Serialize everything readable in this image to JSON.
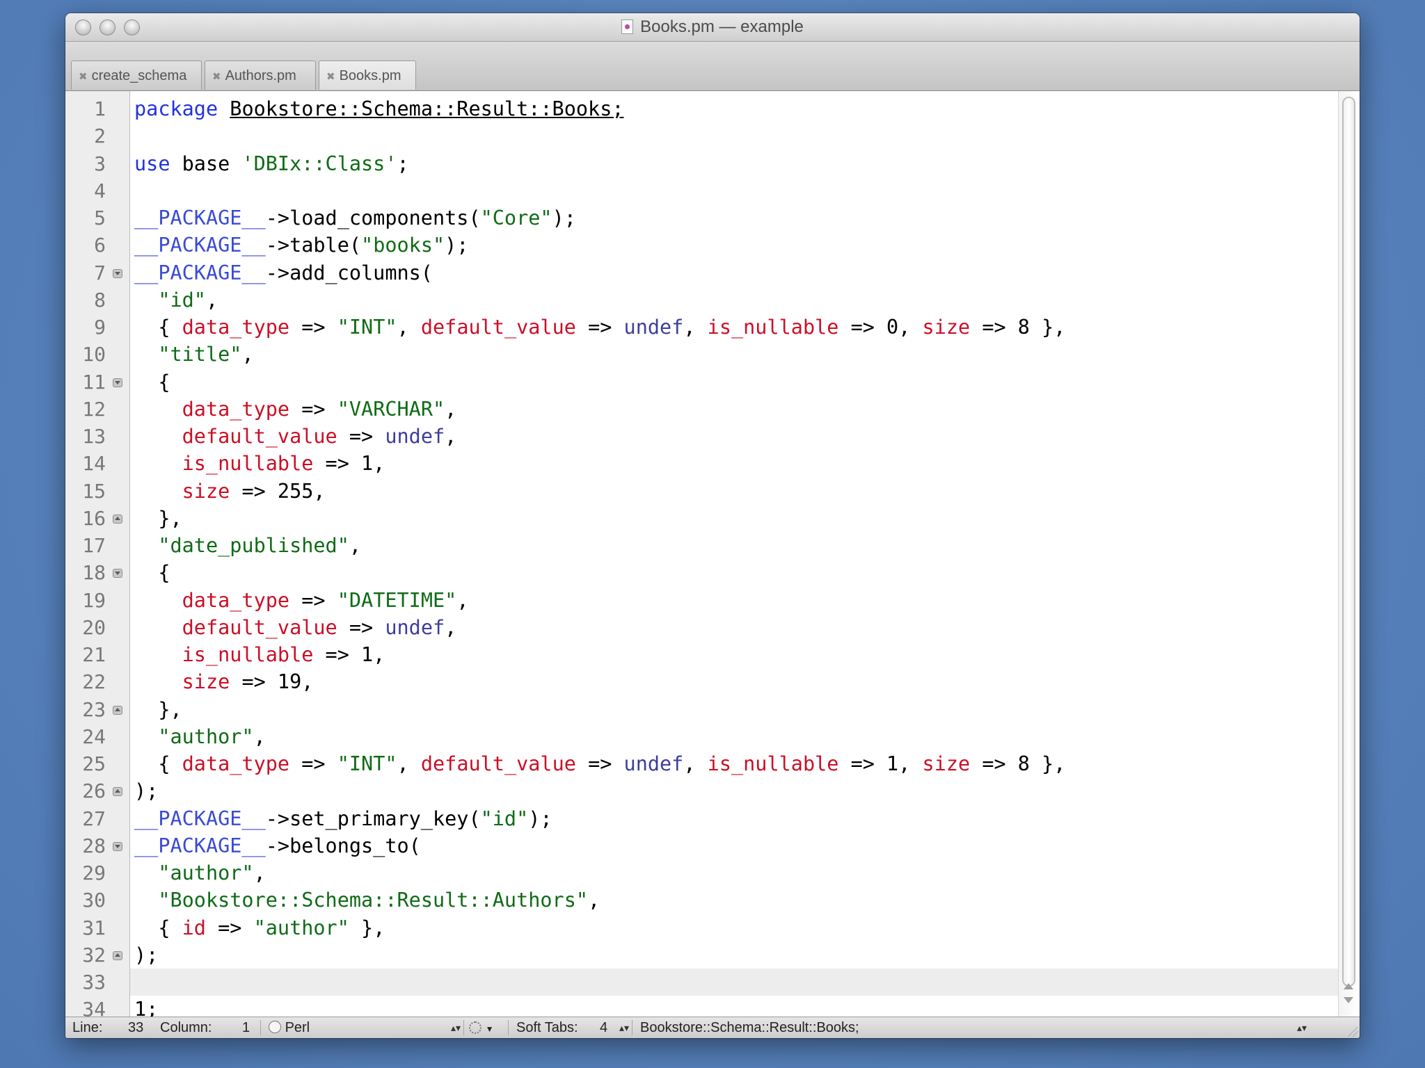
{
  "window": {
    "title": "Books.pm — example"
  },
  "tabs": [
    {
      "label": "create_schema",
      "active": false
    },
    {
      "label": "Authors.pm",
      "active": false
    },
    {
      "label": "Books.pm",
      "active": true
    }
  ],
  "editor": {
    "current_line": 33,
    "lines": [
      {
        "n": "1",
        "html": "<span class=\"kw\">package</span> <span class=\"pkg\">Bookstore::Schema::Result::Books;</span>"
      },
      {
        "n": "2",
        "html": ""
      },
      {
        "n": "3",
        "html": "<span class=\"kw\">use</span> base <span class=\"str\">'DBIx::Class'</span>;"
      },
      {
        "n": "4",
        "html": ""
      },
      {
        "n": "5",
        "html": "<span class=\"pk\">__PACKAGE__</span>-&gt;load_components(<span class=\"str\">\"Core\"</span>);"
      },
      {
        "n": "6",
        "html": "<span class=\"pk\">__PACKAGE__</span>-&gt;table(<span class=\"str\">\"books\"</span>);"
      },
      {
        "n": "7",
        "html": "<span class=\"pk\">__PACKAGE__</span>-&gt;add_columns(",
        "fold": "start"
      },
      {
        "n": "8",
        "html": "  <span class=\"str\">\"id\"</span>,"
      },
      {
        "n": "9",
        "html": "  { <span class=\"key\">data_type</span> =&gt; <span class=\"str\">\"INT\"</span>, <span class=\"key\">default_value</span> =&gt; <span class=\"und\">undef</span>, <span class=\"key\">is_nullable</span> =&gt; 0, <span class=\"key\">size</span> =&gt; 8 },"
      },
      {
        "n": "10",
        "html": "  <span class=\"str\">\"title\"</span>,"
      },
      {
        "n": "11",
        "html": "  {",
        "fold": "start"
      },
      {
        "n": "12",
        "html": "    <span class=\"key\">data_type</span> =&gt; <span class=\"str\">\"VARCHAR\"</span>,"
      },
      {
        "n": "13",
        "html": "    <span class=\"key\">default_value</span> =&gt; <span class=\"und\">undef</span>,"
      },
      {
        "n": "14",
        "html": "    <span class=\"key\">is_nullable</span> =&gt; 1,"
      },
      {
        "n": "15",
        "html": "    <span class=\"key\">size</span> =&gt; 255,"
      },
      {
        "n": "16",
        "html": "  },",
        "fold": "end"
      },
      {
        "n": "17",
        "html": "  <span class=\"str\">\"date_published\"</span>,"
      },
      {
        "n": "18",
        "html": "  {",
        "fold": "start"
      },
      {
        "n": "19",
        "html": "    <span class=\"key\">data_type</span> =&gt; <span class=\"str\">\"DATETIME\"</span>,"
      },
      {
        "n": "20",
        "html": "    <span class=\"key\">default_value</span> =&gt; <span class=\"und\">undef</span>,"
      },
      {
        "n": "21",
        "html": "    <span class=\"key\">is_nullable</span> =&gt; 1,"
      },
      {
        "n": "22",
        "html": "    <span class=\"key\">size</span> =&gt; 19,"
      },
      {
        "n": "23",
        "html": "  },",
        "fold": "end"
      },
      {
        "n": "24",
        "html": "  <span class=\"str\">\"author\"</span>,"
      },
      {
        "n": "25",
        "html": "  { <span class=\"key\">data_type</span> =&gt; <span class=\"str\">\"INT\"</span>, <span class=\"key\">default_value</span> =&gt; <span class=\"und\">undef</span>, <span class=\"key\">is_nullable</span> =&gt; 1, <span class=\"key\">size</span> =&gt; 8 },"
      },
      {
        "n": "26",
        "html": ");",
        "fold": "end"
      },
      {
        "n": "27",
        "html": "<span class=\"pk\">__PACKAGE__</span>-&gt;set_primary_key(<span class=\"str\">\"id\"</span>);"
      },
      {
        "n": "28",
        "html": "<span class=\"pk\">__PACKAGE__</span>-&gt;belongs_to(",
        "fold": "start"
      },
      {
        "n": "29",
        "html": "  <span class=\"str\">\"author\"</span>,"
      },
      {
        "n": "30",
        "html": "  <span class=\"str\">\"Bookstore::Schema::Result::Authors\"</span>,"
      },
      {
        "n": "31",
        "html": "  { <span class=\"key\">id</span> =&gt; <span class=\"str\">\"author\"</span> },"
      },
      {
        "n": "32",
        "html": ");",
        "fold": "end"
      },
      {
        "n": "33",
        "html": ""
      },
      {
        "n": "34",
        "html": "1;"
      }
    ]
  },
  "status": {
    "line_label": "Line:",
    "line_value": "33",
    "column_label": "Column:",
    "column_value": "1",
    "language": "Perl",
    "tabs_label": "Soft Tabs:",
    "tabs_value": "4",
    "symbol": "Bookstore::Schema::Result::Books;",
    "updown": "▴▾"
  },
  "colors": {
    "keyword": "#2233dd",
    "string": "#0f6b16",
    "hash_key": "#cc0f26",
    "package_token": "#3a4bd6",
    "undef": "#3d3d9c"
  }
}
